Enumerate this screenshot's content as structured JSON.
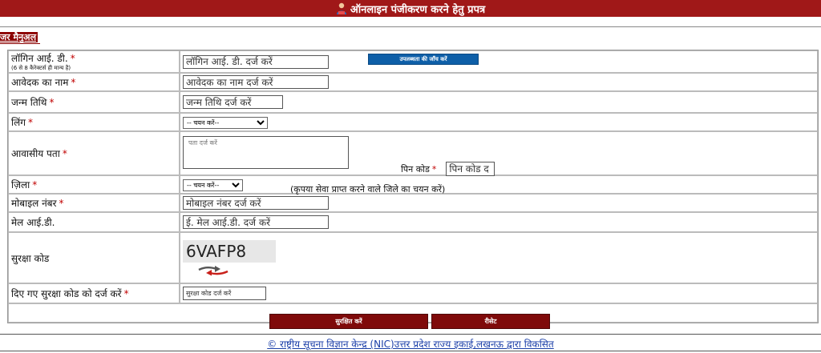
{
  "header": {
    "title": "ऑनलाइन पंजीकरण करने हेतु प्रपत्र",
    "icon": "user-icon",
    "bg_color": "#a01818"
  },
  "manual_link": "जर मैनुअल",
  "form": {
    "login_id": {
      "label": "लॉगिन आई. डी.",
      "note": "(6 से 8 कैरेक्टर्स ही मान्य है)",
      "placeholder": "लॉगिन आई. डी. दर्ज करें"
    },
    "availability_button": "उपलब्धता की जाँच करें",
    "applicant_name": {
      "label": "आवेदक का नाम",
      "placeholder": "आवेदक का नाम दर्ज करें"
    },
    "dob": {
      "label": "जन्म तिथि",
      "placeholder": "जन्म तिथि दर्ज करें"
    },
    "gender": {
      "label": "लिंग",
      "selected": "-- चयन करें--"
    },
    "address": {
      "label": "आवासीय पता",
      "placeholder": "पता दर्ज करें"
    },
    "pincode": {
      "label": "पिन कोड",
      "placeholder": "पिन कोड द"
    },
    "district": {
      "label": "ज़िला",
      "selected": "-- चयन करें--",
      "hint": "(कृपया सेवा प्राप्त करने वाले जिले का चयन करें)"
    },
    "mobile": {
      "label": "मोबाइल नंबर",
      "placeholder": "मोबाइल नंबर दर्ज करें"
    },
    "email": {
      "label": "मेल आई.डी.",
      "placeholder": "ई. मेल आई.डी. दर्ज करें"
    },
    "security_code": {
      "label": "सुरक्षा कोड",
      "captcha": "6VAFP8",
      "refresh_icon": "refresh-icon"
    },
    "enter_code": {
      "label": "दिए गए सुरक्षा कोड को दर्ज करें",
      "placeholder": "सुरक्षा कोड दर्ज करें"
    },
    "required_mark": "*"
  },
  "buttons": {
    "save": "सुरक्षित करें",
    "reset": "रीसेट"
  },
  "footer": "© राष्ट्रीय सूचना विज्ञान केन्द्र (NIC)उत्तर प्रदेश राज्य इकाई,लखनऊ द्वारा विकसित"
}
